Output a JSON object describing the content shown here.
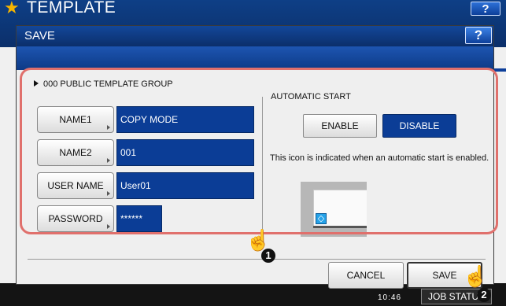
{
  "background": {
    "title": "TEMPLATE",
    "help_label": "?",
    "time": "10:46",
    "job_status_label": "JOB STATUS"
  },
  "dialog": {
    "title": "SAVE",
    "help_label": "?",
    "group_label": "000 PUBLIC TEMPLATE GROUP",
    "fields": [
      {
        "button_label": "NAME1",
        "value": "COPY MODE"
      },
      {
        "button_label": "NAME2",
        "value": "001"
      },
      {
        "button_label": "USER NAME",
        "value": "User01"
      },
      {
        "button_label": "PASSWORD",
        "value": "******"
      }
    ],
    "automatic_start": {
      "label": "AUTOMATIC START",
      "options": [
        "ENABLE",
        "DISABLE"
      ],
      "selected": "DISABLE",
      "note": "This icon is indicated when an automatic start is enabled."
    },
    "buttons": {
      "cancel": "CANCEL",
      "save": "SAVE"
    }
  },
  "callouts": {
    "step1": "1",
    "step2": "2"
  },
  "colors": {
    "title_bar": "#0b2f6a",
    "field_value_bg": "#0b3d96",
    "selected_toggle": "#0b3d96",
    "callout_outline": "#e0706c",
    "auto_start_icon": "#25a2e8"
  },
  "icons": {
    "star": "star-icon",
    "help": "help-icon",
    "auto_start": "auto-start-icon",
    "hand_pointer": "hand-pointer-icon"
  }
}
